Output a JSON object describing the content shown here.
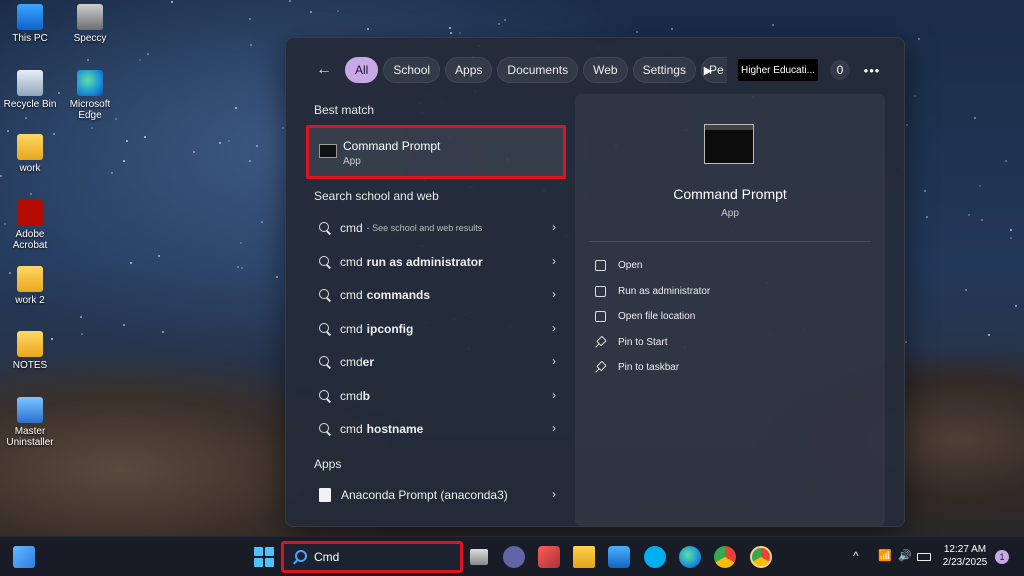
{
  "desktop": {
    "icons": [
      {
        "label": "This PC"
      },
      {
        "label": "Speccy"
      },
      {
        "label": "Recycle Bin"
      },
      {
        "label": "Microsoft Edge"
      },
      {
        "label": "work"
      },
      {
        "label": "Adobe Acrobat"
      },
      {
        "label": "work 2"
      },
      {
        "label": "NOTES"
      },
      {
        "label": "Master Uninstaller"
      }
    ]
  },
  "search_panel": {
    "filters": [
      "All",
      "School",
      "Apps",
      "Documents",
      "Web",
      "Settings",
      "Pe"
    ],
    "active_filter": "All",
    "org_badge": "Higher Educati...",
    "points": "0",
    "more": "•••",
    "sections": {
      "best_match": "Best match",
      "search_web": "Search school and web",
      "apps": "Apps"
    },
    "best_match": {
      "title": "Command Prompt",
      "subtitle": "App"
    },
    "suggestions": [
      {
        "query": "cmd",
        "bold": "",
        "hint": "- See school and web results"
      },
      {
        "query": "cmd",
        "bold": "run as administrator",
        "hint": ""
      },
      {
        "query": "cmd",
        "bold": "commands",
        "hint": ""
      },
      {
        "query": "cmd",
        "bold": "ipconfig",
        "hint": ""
      },
      {
        "query": "cmd",
        "bold": "er",
        "hint": ""
      },
      {
        "query": "cmd",
        "bold": "b",
        "hint": ""
      },
      {
        "query": "cmd",
        "bold": "hostname",
        "hint": ""
      }
    ],
    "apps": [
      {
        "label": "Anaconda Prompt (anaconda3)"
      }
    ],
    "preview": {
      "title": "Command Prompt",
      "subtitle": "App",
      "actions": [
        "Open",
        "Run as administrator",
        "Open file location",
        "Pin to Start",
        "Pin to taskbar"
      ]
    }
  },
  "taskbar": {
    "search_value": "Cmd",
    "clock_time": "12:27 AM",
    "clock_date": "2/23/2025",
    "notification_count": "1"
  },
  "icons": {
    "back": "←",
    "play": "▶",
    "chevron": "›",
    "tray_chevron": "^",
    "wifi": "📶",
    "volume": "🔊"
  }
}
